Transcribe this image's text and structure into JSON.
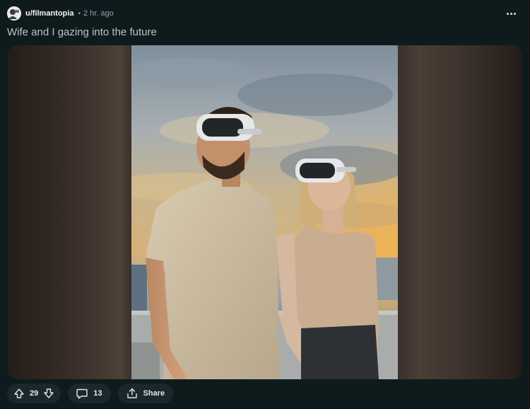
{
  "post": {
    "author": "u/filmantopia",
    "separator": "•",
    "timestamp": "2 hr. ago",
    "title": "Wife and I gazing into the future"
  },
  "actions": {
    "vote_count": "29",
    "comment_count": "13",
    "share_label": "Share"
  },
  "icons": {
    "upvote": "arrow-up-icon",
    "downvote": "arrow-down-icon",
    "comment": "comment-bubble-icon",
    "share": "share-icon",
    "more": "more-dots-icon"
  },
  "colors": {
    "background": "#0f1a1c",
    "pill": "#1a282d",
    "muted_text": "#8ba2ad"
  }
}
